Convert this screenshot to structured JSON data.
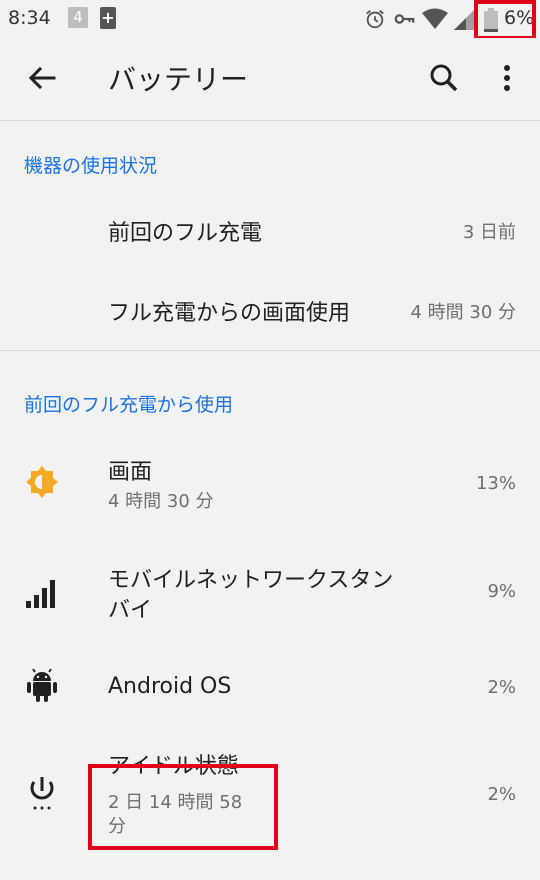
{
  "status_bar": {
    "time": "8:34",
    "notification_count": "4",
    "battery_percent": "6%",
    "icons": [
      "alarm-icon",
      "vpn-key-icon",
      "wifi-icon",
      "cell-signal-icon",
      "battery-icon"
    ]
  },
  "app_bar": {
    "title": "バッテリー",
    "back_icon": "arrow-back-icon",
    "search_icon": "search-icon",
    "more_icon": "more-vert-icon"
  },
  "device_usage": {
    "header": "機器の使用状況",
    "items": [
      {
        "label": "前回のフル充電",
        "value": "3 日前"
      },
      {
        "label": "フル充電からの画面使用",
        "value": "4 時間 30 分"
      }
    ]
  },
  "since_full_charge": {
    "header": "前回のフル充電から使用",
    "items": [
      {
        "icon": "brightness-icon",
        "title": "画面",
        "subtitle": "4 時間 30 分",
        "value": "13%"
      },
      {
        "icon": "cell-signal-icon",
        "title_line1": "モバイルネットワークスタン",
        "title_line2": "バイ",
        "value": "9%"
      },
      {
        "icon": "android-icon",
        "title": "Android OS",
        "value": "2%"
      },
      {
        "icon": "power-icon",
        "title": "アイドル状態",
        "subtitle_line1": "2 日 14 時間 58",
        "subtitle_line2": "分",
        "value": "2%"
      }
    ]
  },
  "colors": {
    "background": "#f2f2f2",
    "accent": "#1a73e8",
    "highlight_box": "#e0001a",
    "icon_orange": "#f4a922"
  }
}
